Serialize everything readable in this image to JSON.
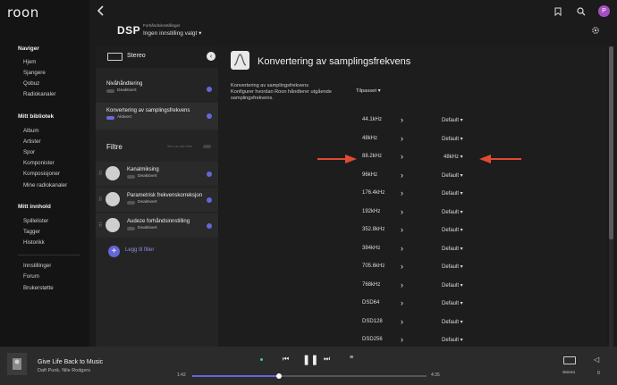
{
  "app": {
    "logo": "roon"
  },
  "sidebar": {
    "sections": [
      {
        "title": "Naviger",
        "items": [
          "Hjem",
          "Sjangere",
          "Qobuz",
          "Radiokanaler"
        ]
      },
      {
        "title": "Mitt bibliotek",
        "items": [
          "Album",
          "Artister",
          "Spor",
          "Komponister",
          "Komposisjoner",
          "Mine radiokanaler"
        ]
      },
      {
        "title": "Mitt innhold",
        "items": [
          "Spillelister",
          "Tagger",
          "Historikk"
        ]
      },
      {
        "title": "",
        "items": [
          "Innstillinger",
          "Forum",
          "Brukerstøtte"
        ]
      }
    ]
  },
  "header": {
    "title": "DSP",
    "preset_caption": "Forhåndsinnstillinger",
    "preset_value": "Ingen innstilling valgt",
    "avatar_letter": "P"
  },
  "left_panel": {
    "zone": "Stereo",
    "settings": [
      {
        "name": "Nivåhåndtering",
        "state": "Deaktivert",
        "on": false
      },
      {
        "name": "Konvertering av samplingsfrekvens",
        "state": "Aktivert",
        "on": true
      }
    ],
    "filters_title": "Filtre",
    "show_all_label": "Skru av alle filtre",
    "filters": [
      {
        "name": "Kanalmiksing",
        "state": "Deaktivert"
      },
      {
        "name": "Parametrisk frekvenskorreksjon",
        "state": "Deaktivert"
      },
      {
        "name": "Audeze forhåndsinnstilling",
        "state": "Deaktivert"
      }
    ],
    "add_filter": "Legg til filter"
  },
  "right_panel": {
    "title": "Konvertering av samplingsfrekvens",
    "subtitle": "Konvertering av samplingsfrekvens",
    "description": "Konfigurer hvordan Roon håndterer utgående samplingsfrekvens.",
    "mode": "Tilpasset",
    "rates": [
      {
        "rate": "44.1kHz",
        "value": "Default"
      },
      {
        "rate": "48kHz",
        "value": "Default"
      },
      {
        "rate": "88.2kHz",
        "value": "48kHz"
      },
      {
        "rate": "96kHz",
        "value": "Default"
      },
      {
        "rate": "176.4kHz",
        "value": "Default"
      },
      {
        "rate": "192kHz",
        "value": "Default"
      },
      {
        "rate": "352.8kHz",
        "value": "Default"
      },
      {
        "rate": "384kHz",
        "value": "Default"
      },
      {
        "rate": "705.6kHz",
        "value": "Default"
      },
      {
        "rate": "768kHz",
        "value": "Default"
      },
      {
        "rate": "DSD64",
        "value": "Default"
      },
      {
        "rate": "DSD128",
        "value": "Default"
      },
      {
        "rate": "DSD256",
        "value": "Default"
      }
    ],
    "annotation_color": "#e24a33"
  },
  "player": {
    "track_title": "Give Life Back to Music",
    "artist": "Daft Punk, Nile Rodgers",
    "time_current": "1:42",
    "time_total": "4:35",
    "progress_fraction": 0.37,
    "zone": "Stereo",
    "volume": "0"
  },
  "colors": {
    "accent": "#6566d8",
    "avatar": "#a64fc3",
    "playing_dot": "#3fd28b"
  }
}
